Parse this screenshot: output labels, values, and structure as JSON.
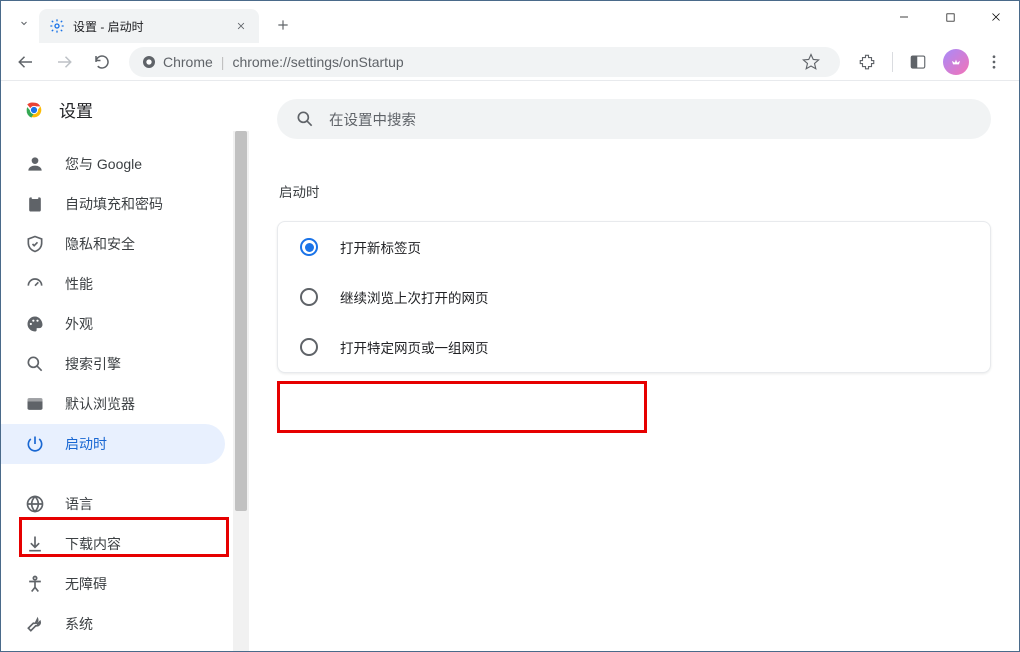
{
  "window": {
    "tab_title": "设置 - 启动时",
    "url_scheme_label": "Chrome",
    "url": "chrome://settings/onStartup"
  },
  "sidebar": {
    "header": "设置",
    "items": [
      {
        "label": "您与 Google",
        "icon": "person-icon"
      },
      {
        "label": "自动填充和密码",
        "icon": "clipboard-icon"
      },
      {
        "label": "隐私和安全",
        "icon": "shield-icon"
      },
      {
        "label": "性能",
        "icon": "speedometer-icon"
      },
      {
        "label": "外观",
        "icon": "palette-icon"
      },
      {
        "label": "搜索引擎",
        "icon": "search-icon"
      },
      {
        "label": "默认浏览器",
        "icon": "browser-icon"
      },
      {
        "label": "启动时",
        "icon": "power-icon"
      }
    ],
    "items2": [
      {
        "label": "语言",
        "icon": "globe-icon"
      },
      {
        "label": "下载内容",
        "icon": "download-icon"
      },
      {
        "label": "无障碍",
        "icon": "accessibility-icon"
      },
      {
        "label": "系统",
        "icon": "wrench-icon"
      }
    ]
  },
  "main": {
    "search_placeholder": "在设置中搜索",
    "section_title": "启动时",
    "options": [
      {
        "label": "打开新标签页",
        "checked": true
      },
      {
        "label": "继续浏览上次打开的网页",
        "checked": false
      },
      {
        "label": "打开特定网页或一组网页",
        "checked": false
      }
    ]
  }
}
